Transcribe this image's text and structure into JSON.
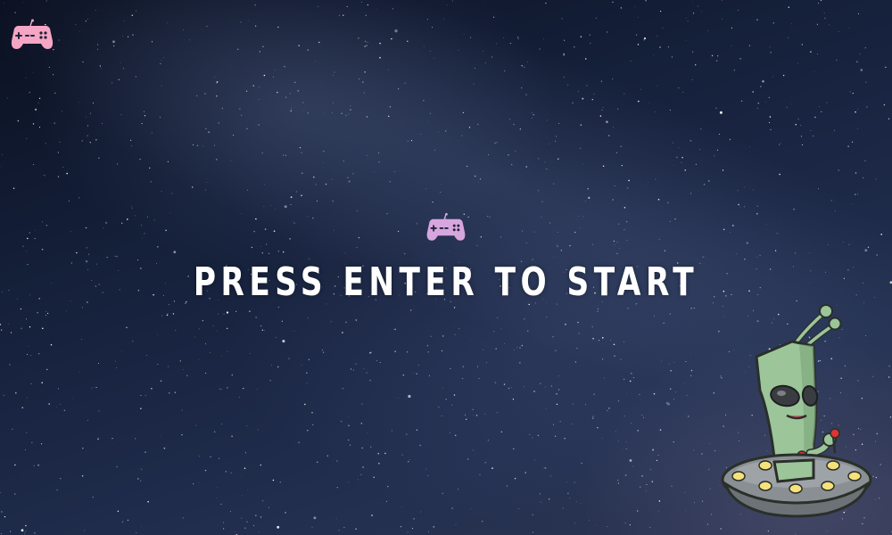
{
  "screen": {
    "prompt_text": "PRESS ENTER TO START"
  },
  "icons": {
    "corner_logo": "gamepad-icon",
    "center_logo": "gamepad-icon",
    "character": "alien-ufo-mascot"
  },
  "colors": {
    "gamepad_corner": "#f4a6c4",
    "gamepad_center": "#d7a6de",
    "alien_skin": "#9cc59a",
    "ufo_body": "#8a8f94",
    "ufo_lights": "#f5e27a",
    "prompt_text": "#ffffff"
  }
}
